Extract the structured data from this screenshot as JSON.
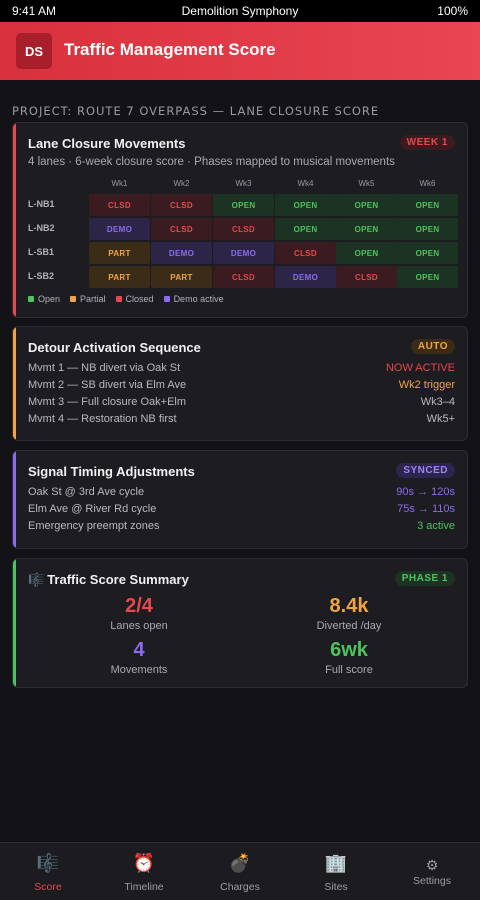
{
  "status_bar": {
    "time": "9:41 AM",
    "title": "Demolition Symphony",
    "battery": "100%"
  },
  "app_bar": {
    "avatar": "DS",
    "title": "Traffic Management Score"
  },
  "section_label": "PROJECT: ROUTE 7 OVERPASS — LANE CLOSURE SCORE",
  "colors": {
    "open": "#4cc35e",
    "partial": "#f2a443",
    "closed": "#e5484d",
    "demo": "#8b6cf0",
    "accent_red": "#e5484d"
  },
  "lane_card": {
    "title": "Lane Closure Movements",
    "badge": "WEEK 1",
    "subtitle": "4 lanes · 6-week closure score · Phases mapped to musical movements",
    "weeks": [
      "Wk1",
      "Wk2",
      "Wk3",
      "Wk4",
      "Wk5",
      "Wk6"
    ],
    "lanes": [
      {
        "name": "L-NB1",
        "cells": [
          {
            "text": "CLSD",
            "state": "clsd"
          },
          {
            "text": "CLSD",
            "state": "clsd"
          },
          {
            "text": "OPEN",
            "state": "open"
          },
          {
            "text": "OPEN",
            "state": "open"
          },
          {
            "text": "OPEN",
            "state": "open"
          },
          {
            "text": "OPEN",
            "state": "open"
          }
        ]
      },
      {
        "name": "L-NB2",
        "cells": [
          {
            "text": "DEMO",
            "state": "demo"
          },
          {
            "text": "CLSD",
            "state": "clsd"
          },
          {
            "text": "CLSD",
            "state": "clsd"
          },
          {
            "text": "OPEN",
            "state": "open"
          },
          {
            "text": "OPEN",
            "state": "open"
          },
          {
            "text": "OPEN",
            "state": "open"
          }
        ]
      },
      {
        "name": "L-SB1",
        "cells": [
          {
            "text": "PART",
            "state": "part"
          },
          {
            "text": "DEMO",
            "state": "demo"
          },
          {
            "text": "DEMO",
            "state": "demo"
          },
          {
            "text": "CLSD",
            "state": "clsd"
          },
          {
            "text": "OPEN",
            "state": "open"
          },
          {
            "text": "OPEN",
            "state": "open"
          }
        ]
      },
      {
        "name": "L-SB2",
        "cells": [
          {
            "text": "PART",
            "state": "part"
          },
          {
            "text": "PART",
            "state": "part"
          },
          {
            "text": "CLSD",
            "state": "clsd"
          },
          {
            "text": "DEMO",
            "state": "demo"
          },
          {
            "text": "CLSD",
            "state": "clsd"
          },
          {
            "text": "OPEN",
            "state": "open"
          }
        ]
      }
    ],
    "legend": [
      {
        "label": "Open",
        "state": "open"
      },
      {
        "label": "Partial",
        "state": "part"
      },
      {
        "label": "Closed",
        "state": "clsd"
      },
      {
        "label": "Demo active",
        "state": "demo"
      }
    ]
  },
  "detour_card": {
    "title": "Detour Activation Sequence",
    "badge": "AUTO",
    "rows": [
      {
        "label": "Mvmt 1 — NB divert via Oak St",
        "value": "NOW ACTIVE",
        "color": "#e5484d"
      },
      {
        "label": "Mvmt 2 — SB divert via Elm Ave",
        "value": "Wk2 trigger",
        "color": "#f2a443"
      },
      {
        "label": "Mvmt 3 — Full closure Oak+Elm",
        "value": "Wk3–4",
        "color": "#b9b9c2"
      },
      {
        "label": "Mvmt 4 — Restoration NB first",
        "value": "Wk5+",
        "color": "#b9b9c2"
      }
    ]
  },
  "signal_card": {
    "title": "Signal Timing Adjustments",
    "badge": "SYNCED",
    "rows": [
      {
        "label": "Oak St @ 3rd Ave cycle",
        "value": "90s → 120s",
        "color": "#8b6cf0"
      },
      {
        "label": "Elm Ave @ River Rd cycle",
        "value": "75s → 110s",
        "color": "#8b6cf0"
      },
      {
        "label": "Emergency preempt zones",
        "value": "3 active",
        "color": "#4cc35e"
      }
    ]
  },
  "summary_card": {
    "title": "Traffic Score Summary",
    "title_icon": "music-score-icon",
    "badge": "PHASE 1",
    "stats": [
      {
        "value": "2/4",
        "label": "Lanes open",
        "color": "#e5484d"
      },
      {
        "value": "8.4k",
        "label": "Diverted /day",
        "color": "#f2a443"
      },
      {
        "value": "4",
        "label": "Movements",
        "color": "#8b6cf0"
      },
      {
        "value": "6wk",
        "label": "Full score",
        "color": "#4cc35e"
      }
    ]
  },
  "tab_bar": {
    "tabs": [
      {
        "label": "Score",
        "icon": "🎼",
        "icon_name": "music-score-icon",
        "active": true
      },
      {
        "label": "Timeline",
        "icon": "⏰",
        "icon_name": "alarm-clock-icon",
        "active": false
      },
      {
        "label": "Charges",
        "icon": "💣",
        "icon_name": "bomb-icon",
        "active": false
      },
      {
        "label": "Sites",
        "icon": "🏢",
        "icon_name": "building-icon",
        "active": false
      },
      {
        "label": "Settings",
        "icon": "⚙",
        "icon_name": "gear-icon",
        "active": false
      }
    ]
  }
}
